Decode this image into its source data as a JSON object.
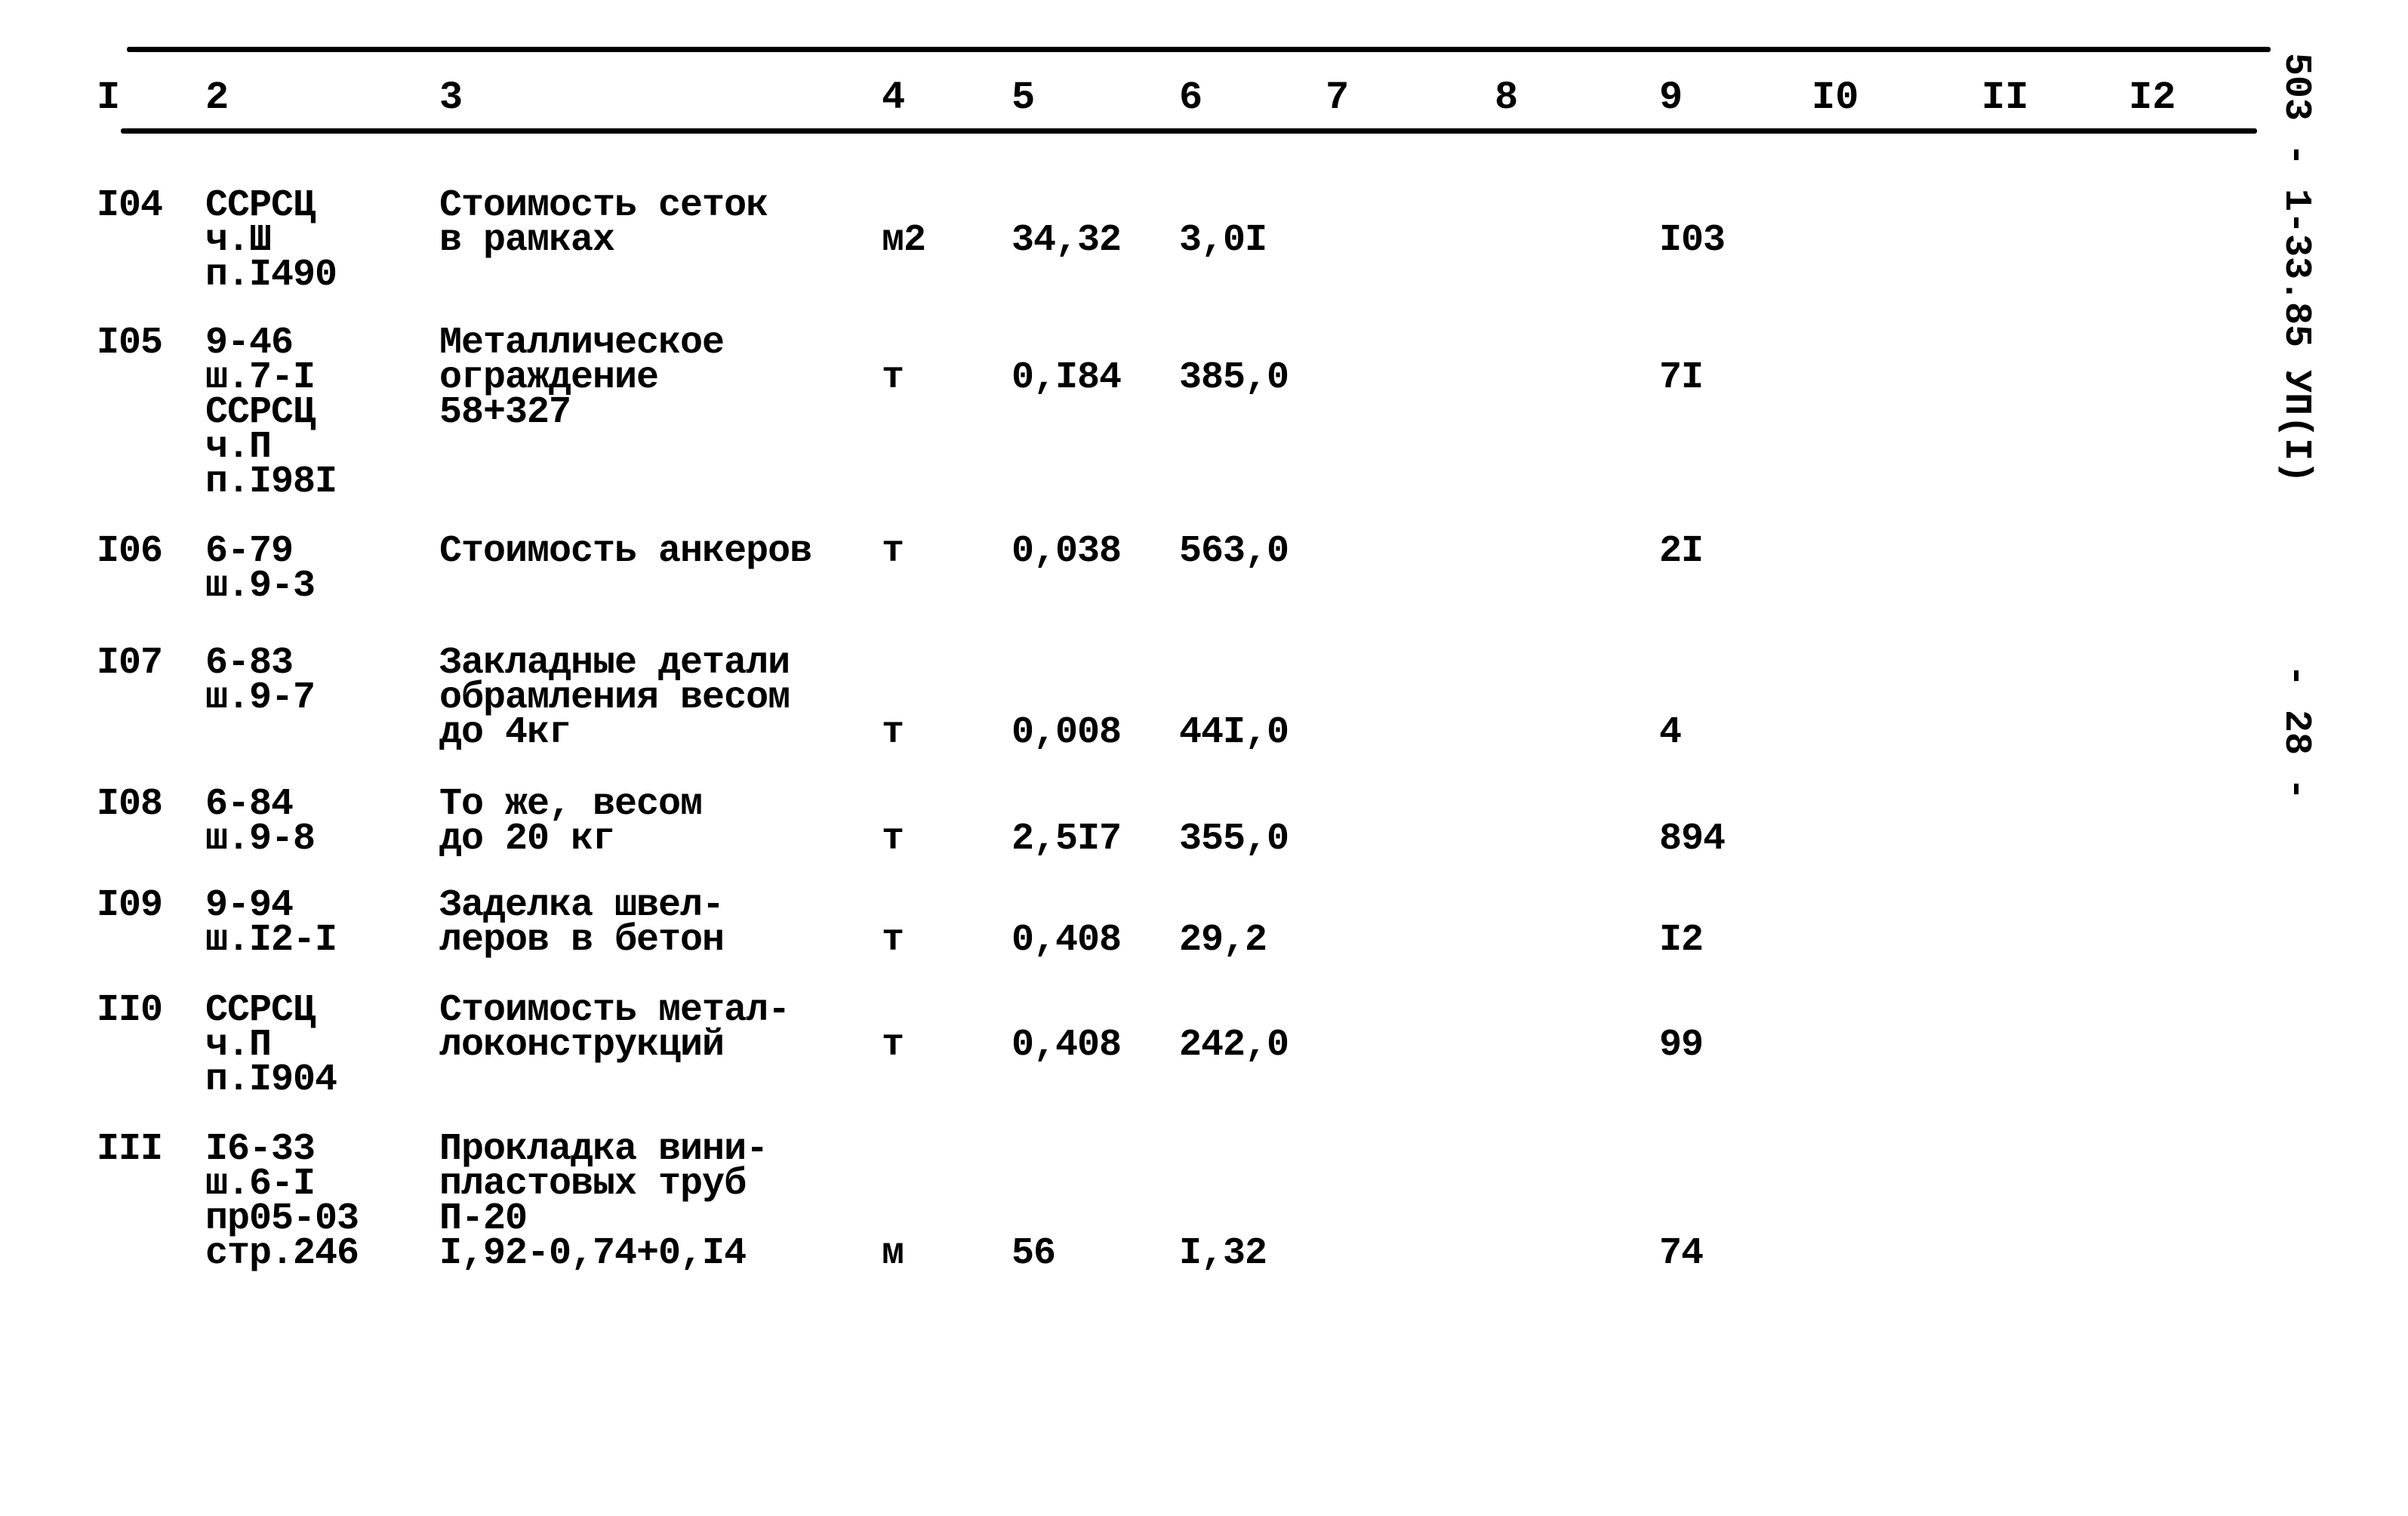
{
  "side_labels": {
    "document_code": "503 - 1-33.85 УП(I)",
    "page_number": "- 28 -"
  },
  "table": {
    "headers": [
      "I",
      "2",
      "3",
      "4",
      "5",
      "6",
      "7",
      "8",
      "9",
      "I0",
      "II",
      "I2"
    ],
    "rows": [
      {
        "no": "I04",
        "ref": "ССРСЦ\nч.Ш\nп.I490",
        "desc": "Стоимость сеток\nв рамках",
        "unit": "м2",
        "qty": "34,32",
        "price": "3,0I",
        "c7": "",
        "c8": "",
        "total": "I03",
        "c10": "",
        "c11": "",
        "c12": ""
      },
      {
        "no": "I05",
        "ref": "9-46\nш.7-I\nССРСЦ\nч.П\nп.I98I",
        "desc": "Металлическое\nограждение\n58+327",
        "unit": "т",
        "qty": "0,I84",
        "price": "385,0",
        "c7": "",
        "c8": "",
        "total": "7I",
        "c10": "",
        "c11": "",
        "c12": ""
      },
      {
        "no": "I06",
        "ref": "6-79\nш.9-3",
        "desc": "Стоимость анкеров",
        "unit": "т",
        "qty": "0,038",
        "price": "563,0",
        "c7": "",
        "c8": "",
        "total": "2I",
        "c10": "",
        "c11": "",
        "c12": ""
      },
      {
        "no": "I07",
        "ref": "6-83\nш.9-7",
        "desc": "Закладные детали\nобрамления весом\nдо 4кг",
        "unit": "т",
        "qty": "0,008",
        "price": "44I,0",
        "c7": "",
        "c8": "",
        "total": "4",
        "c10": "",
        "c11": "",
        "c12": ""
      },
      {
        "no": "I08",
        "ref": "6-84\nш.9-8",
        "desc": "То же, весом\nдо 20 кг",
        "unit": "т",
        "qty": "2,5I7",
        "price": "355,0",
        "c7": "",
        "c8": "",
        "total": "894",
        "c10": "",
        "c11": "",
        "c12": ""
      },
      {
        "no": "I09",
        "ref": "9-94\nш.I2-I",
        "desc": "Заделка швел-\nлеров в бетон",
        "unit": "т",
        "qty": "0,408",
        "price": "29,2",
        "c7": "",
        "c8": "",
        "total": "I2",
        "c10": "",
        "c11": "",
        "c12": ""
      },
      {
        "no": "II0",
        "ref": "ССРСЦ\nч.П\nп.I904",
        "desc": "Стоимость метал-\nлоконструкций",
        "unit": "т",
        "qty": "0,408",
        "price": "242,0",
        "c7": "",
        "c8": "",
        "total": "99",
        "c10": "",
        "c11": "",
        "c12": ""
      },
      {
        "no": "III",
        "ref": "I6-33\nш.6-I\nпр05-03\nстр.246",
        "desc": "Прокладка вини-\nпластовых труб\nП-20\nI,92-0,74+0,I4",
        "unit": "м",
        "qty": "56",
        "price": "I,32",
        "c7": "",
        "c8": "",
        "total": "74",
        "c10": "",
        "c11": "",
        "c12": ""
      }
    ]
  }
}
